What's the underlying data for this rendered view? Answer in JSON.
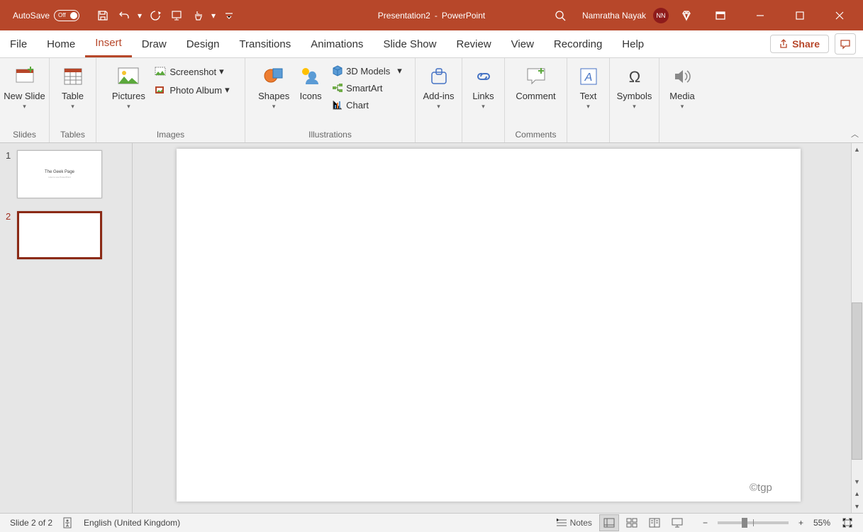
{
  "titlebar": {
    "autosave_label": "AutoSave",
    "autosave_state": "Off",
    "doc_name": "Presentation2",
    "app_name_sep": "  -  ",
    "app_name": "PowerPoint",
    "user_name": "Namratha Nayak",
    "user_initials": "NN"
  },
  "tabs": {
    "file": "File",
    "home": "Home",
    "insert": "Insert",
    "draw": "Draw",
    "design": "Design",
    "transitions": "Transitions",
    "animations": "Animations",
    "slideshow": "Slide Show",
    "review": "Review",
    "view": "View",
    "recording": "Recording",
    "help": "Help",
    "share": "Share"
  },
  "ribbon": {
    "slides": {
      "new_slide": "New Slide",
      "label": "Slides"
    },
    "tables": {
      "table": "Table",
      "label": "Tables"
    },
    "images": {
      "pictures": "Pictures",
      "screenshot": "Screenshot",
      "photo_album": "Photo Album",
      "label": "Images"
    },
    "illustrations": {
      "shapes": "Shapes",
      "icons": "Icons",
      "models": "3D Models",
      "smartart": "SmartArt",
      "chart": "Chart",
      "label": "Illustrations"
    },
    "addins": {
      "addins": "Add-ins",
      "label": ""
    },
    "links": {
      "links": "Links",
      "label": ""
    },
    "comments": {
      "comment": "Comment",
      "label": "Comments"
    },
    "text": {
      "text": "Text"
    },
    "symbols": {
      "symbols": "Symbols"
    },
    "media": {
      "media": "Media"
    }
  },
  "thumbnails": {
    "s1_num": "1",
    "s1_title": "The Geek Page",
    "s1_sub": "How to use PowerPoint",
    "s2_num": "2"
  },
  "canvas": {
    "watermark": "©tgp"
  },
  "status": {
    "slide_info": "Slide 2 of 2",
    "language": "English (United Kingdom)",
    "notes": "Notes",
    "zoom": "55%"
  }
}
